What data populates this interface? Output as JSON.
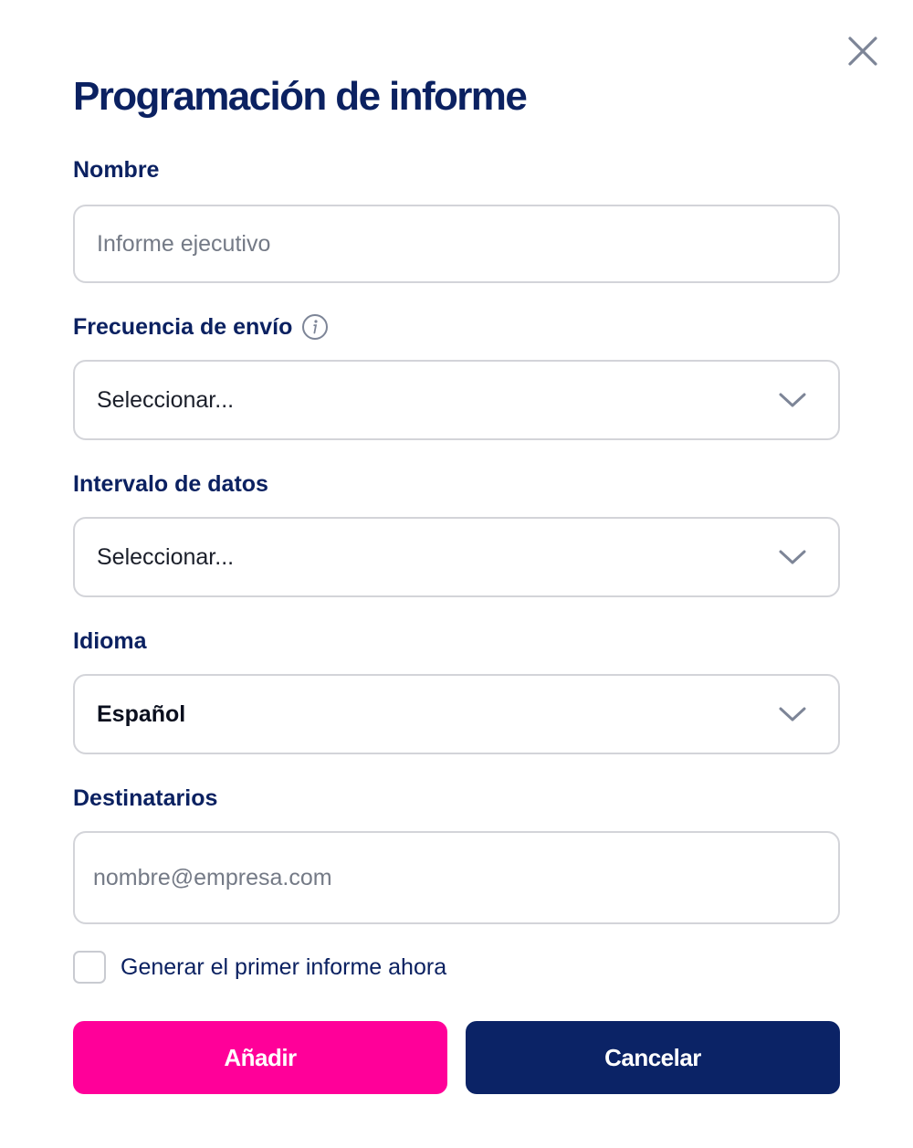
{
  "dialog": {
    "title": "Programación de informe",
    "close_icon": "close-icon"
  },
  "form": {
    "name": {
      "label": "Nombre",
      "value": "",
      "placeholder": "Informe ejecutivo"
    },
    "frequency": {
      "label": "Frecuencia de envío",
      "info_icon": "info-icon",
      "value": "Seleccionar..."
    },
    "interval": {
      "label": "Intervalo de datos",
      "value": "Seleccionar..."
    },
    "language": {
      "label": "Idioma",
      "value": "Español"
    },
    "recipients": {
      "label": "Destinatarios",
      "value": "",
      "placeholder": "nombre@empresa.com"
    },
    "generate_now": {
      "label": "Generar el primer informe ahora",
      "checked": false
    }
  },
  "actions": {
    "add_label": "Añadir",
    "cancel_label": "Cancelar"
  },
  "colors": {
    "primary": "#ff0099",
    "navy": "#0b2366",
    "border": "#d3d4d9"
  }
}
